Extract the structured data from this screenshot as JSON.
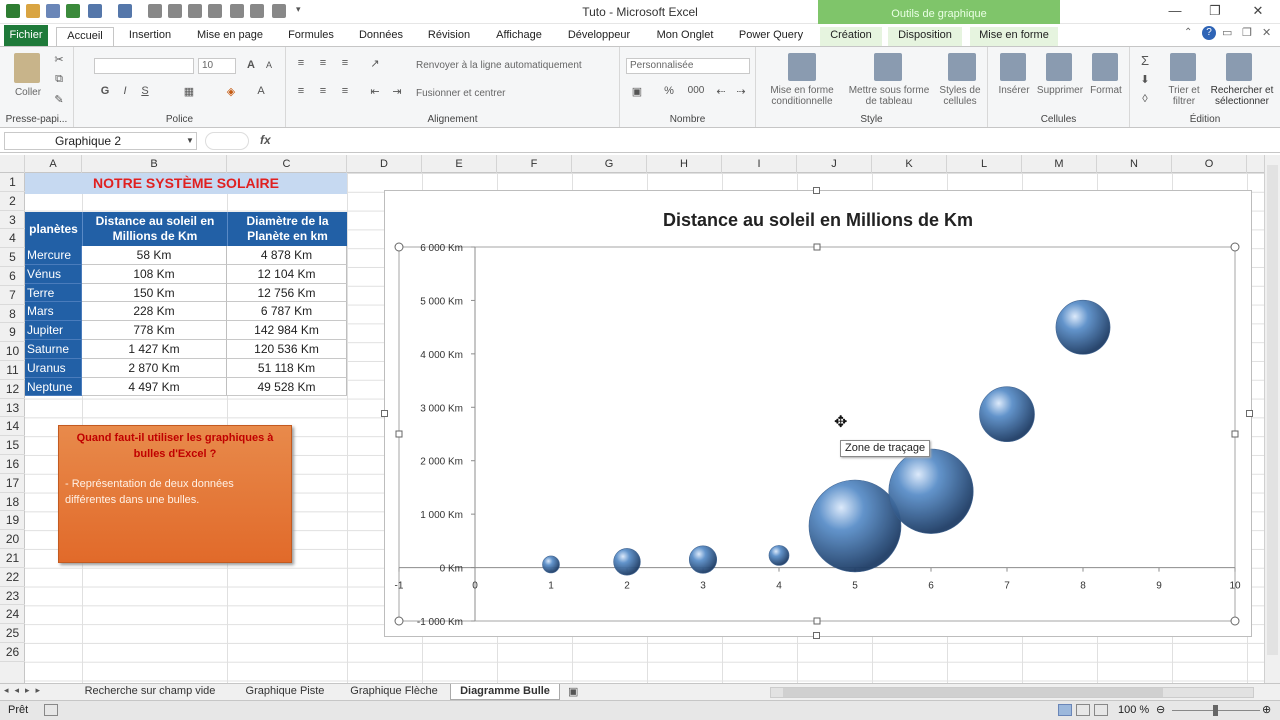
{
  "window": {
    "title": "Tuto  -  Microsoft Excel",
    "context_band": "Outils de graphique"
  },
  "tabs": [
    "Fichier",
    "Accueil",
    "Insertion",
    "Mise en page",
    "Formules",
    "Données",
    "Révision",
    "Affichage",
    "Développeur",
    "Mon Onglet",
    "Power Query",
    "Création",
    "Disposition",
    "Mise en forme"
  ],
  "ribbon": {
    "clipboard": {
      "paste": "Coller",
      "label": "Presse-papi..."
    },
    "font": {
      "size": "10",
      "label": "Police",
      "bold": "G",
      "italic": "I",
      "underline": "S",
      "grow": "A",
      "shrink": "A",
      "color": "A"
    },
    "alignment": {
      "wrap": "Renvoyer à la ligne automatiquement",
      "merge": "Fusionner et centrer",
      "label": "Alignement"
    },
    "number": {
      "format": "Personnalisée",
      "percent": "%",
      "thousands": "000",
      "label": "Nombre"
    },
    "style": {
      "cond": "Mise en forme conditionnelle",
      "table": "Mettre sous forme de tableau",
      "cell": "Styles de cellules",
      "label": "Style"
    },
    "cells": {
      "insert": "Insérer",
      "delete": "Supprimer",
      "format": "Format",
      "label": "Cellules"
    },
    "edit": {
      "sort": "Trier et filtrer",
      "find": "Rechercher et sélectionner",
      "label": "Édition",
      "sigma": "Σ"
    }
  },
  "formula_bar": {
    "name_box": "Graphique 2",
    "fx": "fx"
  },
  "columns": [
    "A",
    "B",
    "C",
    "D",
    "E",
    "F",
    "G",
    "H",
    "I",
    "J",
    "K",
    "L",
    "M",
    "N",
    "O"
  ],
  "rows": [
    "1",
    "2",
    "3",
    "4",
    "5",
    "6",
    "7",
    "8",
    "9",
    "10",
    "11",
    "12",
    "13",
    "14",
    "15",
    "16",
    "17",
    "18",
    "19",
    "20",
    "21",
    "22",
    "23",
    "24",
    "25",
    "26"
  ],
  "sheet": {
    "title": "NOTRE SYSTÈME SOLAIRE",
    "headers": [
      "planètes",
      "Distance au soleil en Millions de Km",
      "Diamètre de la Planète en km"
    ],
    "planets": [
      {
        "name": "Mercure",
        "distance": "58 Km",
        "diameter": "4 878 Km"
      },
      {
        "name": "Vénus",
        "distance": "108 Km",
        "diameter": "12 104 Km"
      },
      {
        "name": "Terre",
        "distance": "150 Km",
        "diameter": "12 756 Km"
      },
      {
        "name": "Mars",
        "distance": "228 Km",
        "diameter": "6 787 Km"
      },
      {
        "name": "Jupiter",
        "distance": "778 Km",
        "diameter": "142 984 Km"
      },
      {
        "name": "Saturne",
        "distance": "1 427 Km",
        "diameter": "120 536 Km"
      },
      {
        "name": "Uranus",
        "distance": "2 870 Km",
        "diameter": "51 118 Km"
      },
      {
        "name": "Neptune",
        "distance": "4 497 Km",
        "diameter": "49 528 Km"
      }
    ],
    "note": {
      "title": "Quand faut-il utiliser les graphiques à bulles d'Excel ?",
      "body": "- Représentation de deux données différentes dans une bulles."
    }
  },
  "chart_data": {
    "type": "bubble",
    "title": "Distance au soleil en Millions de Km",
    "xlim": [
      -1,
      10
    ],
    "ylim": [
      -1000,
      6000
    ],
    "x_ticks": [
      "-1",
      "0",
      "1",
      "2",
      "3",
      "4",
      "5",
      "6",
      "7",
      "8",
      "9",
      "10"
    ],
    "y_ticks": [
      "-1 000 Km",
      "0 Km",
      "1 000 Km",
      "2 000 Km",
      "3 000 Km",
      "4 000 Km",
      "5 000 Km",
      "6 000 Km"
    ],
    "x": [
      1,
      2,
      3,
      4,
      5,
      6,
      7,
      8
    ],
    "y": [
      58,
      108,
      150,
      228,
      778,
      1427,
      2870,
      4497
    ],
    "size": [
      4878,
      12104,
      12756,
      6787,
      142984,
      120536,
      51118,
      49528
    ],
    "bubble_color": "#5b8fc9",
    "tooltip": "Zone de traçage"
  },
  "sheet_tabs": [
    "Recherche sur champ vide",
    "Graphique Piste",
    "Graphique Flèche",
    "Diagramme Bulle"
  ],
  "status": {
    "ready": "Prêt",
    "zoom": "100 %"
  }
}
